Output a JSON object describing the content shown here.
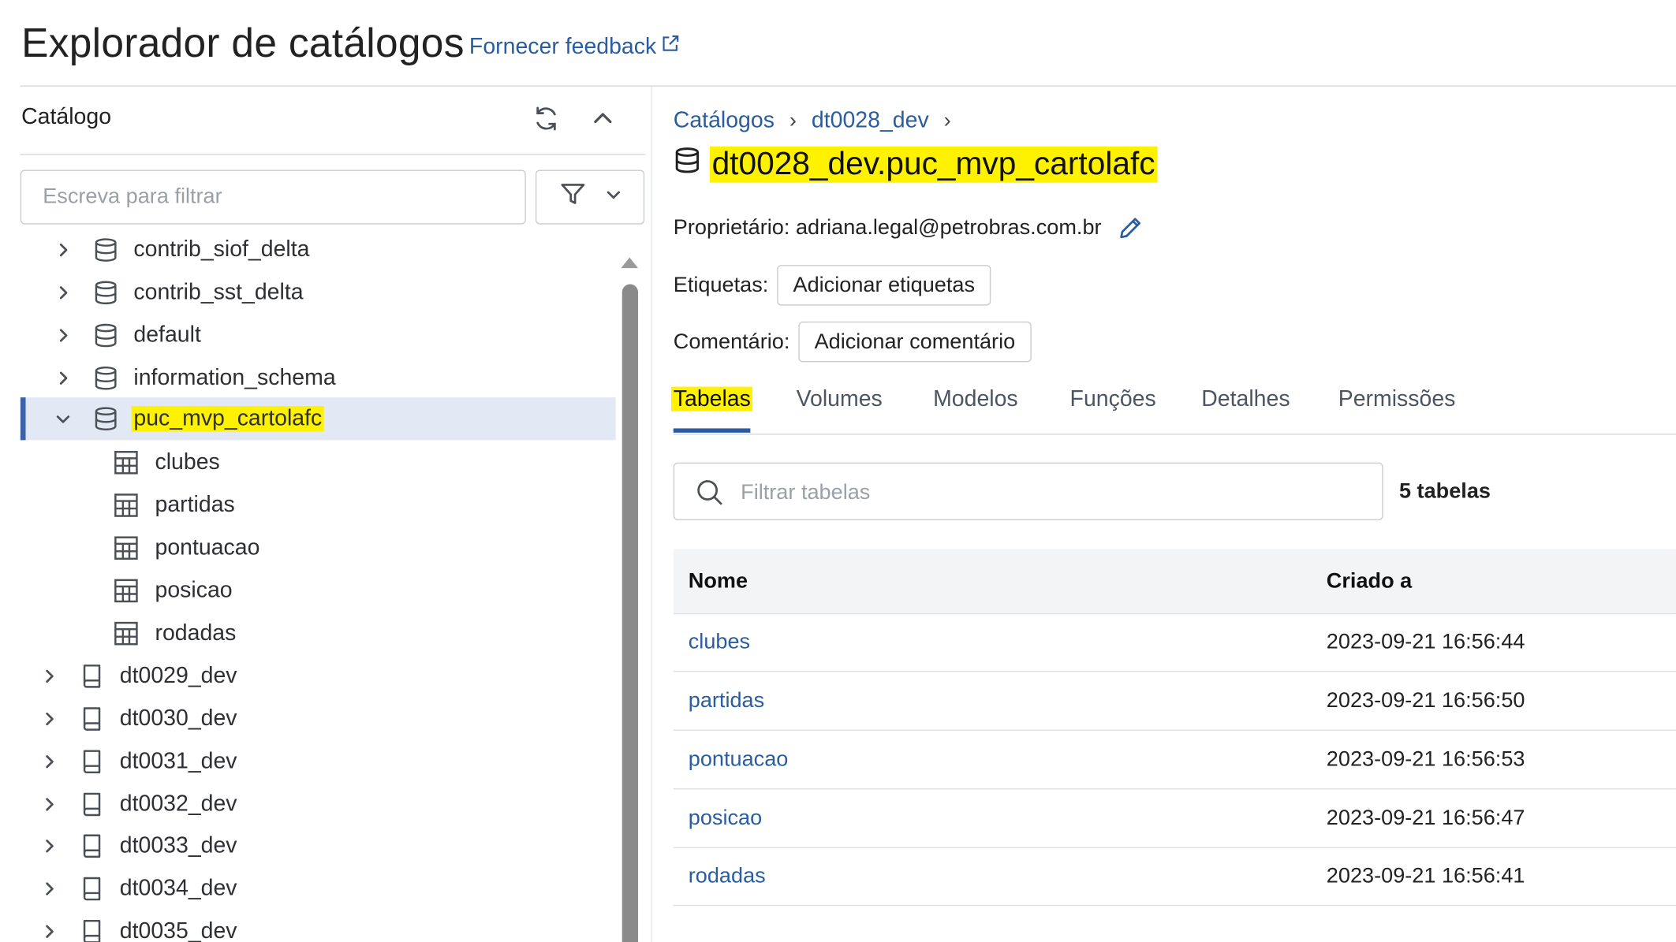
{
  "header": {
    "title": "Explorador de catálogos",
    "feedback_label": "Fornecer feedback"
  },
  "left_panel": {
    "title": "Catálogo",
    "filter_placeholder": "Escreva para filtrar",
    "tree": [
      {
        "label": "contrib_siof_delta",
        "type": "schema",
        "expanded": false
      },
      {
        "label": "contrib_sst_delta",
        "type": "schema",
        "expanded": false
      },
      {
        "label": "default",
        "type": "schema",
        "expanded": false
      },
      {
        "label": "information_schema",
        "type": "schema",
        "expanded": false
      },
      {
        "label": "puc_mvp_cartolafc",
        "type": "schema",
        "expanded": true,
        "selected": true,
        "highlighted": true
      },
      {
        "label": "clubes",
        "type": "table"
      },
      {
        "label": "partidas",
        "type": "table"
      },
      {
        "label": "pontuacao",
        "type": "table"
      },
      {
        "label": "posicao",
        "type": "table"
      },
      {
        "label": "rodadas",
        "type": "table"
      },
      {
        "label": "dt0029_dev",
        "type": "catalog",
        "expanded": false
      },
      {
        "label": "dt0030_dev",
        "type": "catalog",
        "expanded": false
      },
      {
        "label": "dt0031_dev",
        "type": "catalog",
        "expanded": false
      },
      {
        "label": "dt0032_dev",
        "type": "catalog",
        "expanded": false
      },
      {
        "label": "dt0033_dev",
        "type": "catalog",
        "expanded": false
      },
      {
        "label": "dt0034_dev",
        "type": "catalog",
        "expanded": false
      },
      {
        "label": "dt0035_dev",
        "type": "catalog",
        "expanded": false
      }
    ]
  },
  "breadcrumb": {
    "items": [
      "Catálogos",
      "dt0028_dev"
    ],
    "separator": "›"
  },
  "schema": {
    "full_name": "dt0028_dev.puc_mvp_cartolafc",
    "owner_label": "Proprietário:",
    "owner_value": "adriana.legal@petrobras.com.br",
    "tags_label": "Etiquetas:",
    "tags_button": "Adicionar etiquetas",
    "comment_label": "Comentário:",
    "comment_button": "Adicionar comentário"
  },
  "tabs": [
    {
      "label": "Tabelas",
      "active": true
    },
    {
      "label": "Volumes",
      "active": false
    },
    {
      "label": "Modelos",
      "active": false
    },
    {
      "label": "Funções",
      "active": false
    },
    {
      "label": "Detalhes",
      "active": false
    },
    {
      "label": "Permissões",
      "active": false
    }
  ],
  "tables_view": {
    "filter_placeholder": "Filtrar tabelas",
    "count_label": "5 tabelas",
    "columns": [
      "Nome",
      "Criado a"
    ],
    "rows": [
      {
        "name": "clubes",
        "created": "2023-09-21 16:56:44"
      },
      {
        "name": "partidas",
        "created": "2023-09-21 16:56:50"
      },
      {
        "name": "pontuacao",
        "created": "2023-09-21 16:56:53"
      },
      {
        "name": "posicao",
        "created": "2023-09-21 16:56:47"
      },
      {
        "name": "rodadas",
        "created": "2023-09-21 16:56:41"
      }
    ]
  },
  "colors": {
    "link": "#2a5d9f",
    "highlight": "#fff200",
    "selected_row": "#e3e9f4",
    "accent": "#2c5aa0"
  }
}
